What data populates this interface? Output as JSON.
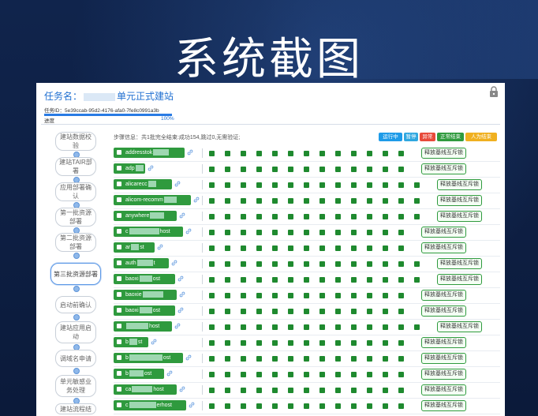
{
  "slide": {
    "title": "系统截图"
  },
  "task": {
    "name_prefix": "任务名：",
    "name_suffix": "单元正式建站",
    "id_line": "任务ID：5e39ccab-95d2-4176-afa0-7fe8c0991a3b",
    "progress_label": "进度",
    "progress_text": "100%",
    "progress_fraction": 1.0
  },
  "steps": [
    {
      "label": "建站数据校验",
      "active": false
    },
    {
      "label": "建站TAIR部署",
      "active": false
    },
    {
      "label": "应用部署确认",
      "active": false
    },
    {
      "label": "第一批资源部署",
      "active": false
    },
    {
      "label": "第二批资源部署",
      "active": false
    },
    {
      "label": "第三批资源部署",
      "active": true
    },
    {
      "label": "启动前确认",
      "active": false
    },
    {
      "label": "建站应用启动",
      "active": false
    },
    {
      "label": "调域名申请",
      "active": false
    },
    {
      "label": "单元敏感业务处理",
      "active": false
    },
    {
      "label": "建站流程结",
      "active": false
    }
  ],
  "info": "步骤信息：共1批完全结束:成功154,跳过0,无需验证;",
  "legend": [
    {
      "label": "运行中",
      "color": "#1e9be8"
    },
    {
      "label": "暂停",
      "color": "#2fa7e0"
    },
    {
      "label": "异常",
      "color": "#e84a3a"
    },
    {
      "label": "正常结束",
      "color": "#2f9a3e"
    },
    {
      "label": "人为结束",
      "color": "#f0b020"
    }
  ],
  "release_label": "释放基线互斥锁",
  "hosts": [
    {
      "pre": "addresstok",
      "post": "",
      "release_col": 1
    },
    {
      "pre": "adp",
      "post": "",
      "release_col": 1
    },
    {
      "pre": "alicarecc",
      "post": "",
      "release_col": 2
    },
    {
      "pre": "alicom-recomm",
      "post": "",
      "release_col": 2
    },
    {
      "pre": "anywhere",
      "post": "",
      "release_col": 2
    },
    {
      "pre": "c",
      "post": "host",
      "release_col": 1
    },
    {
      "pre": "ar",
      "post": "st",
      "release_col": 1
    },
    {
      "pre": "auth",
      "post": "t",
      "release_col": 2
    },
    {
      "pre": "baoxi",
      "post": "ost",
      "release_col": 2
    },
    {
      "pre": "baoxie",
      "post": "",
      "release_col": 1
    },
    {
      "pre": "baoxi",
      "post": "ost",
      "release_col": 1
    },
    {
      "pre": "",
      "post": "host",
      "release_col": 2
    },
    {
      "pre": "b",
      "post": "st",
      "release_col": 1
    },
    {
      "pre": "b",
      "post": "ost",
      "release_col": 1
    },
    {
      "pre": "b",
      "post": "ost",
      "release_col": 1
    },
    {
      "pre": "ca",
      "post": "host",
      "release_col": 1
    },
    {
      "pre": "c",
      "post": "erhost",
      "release_col": 1
    }
  ]
}
